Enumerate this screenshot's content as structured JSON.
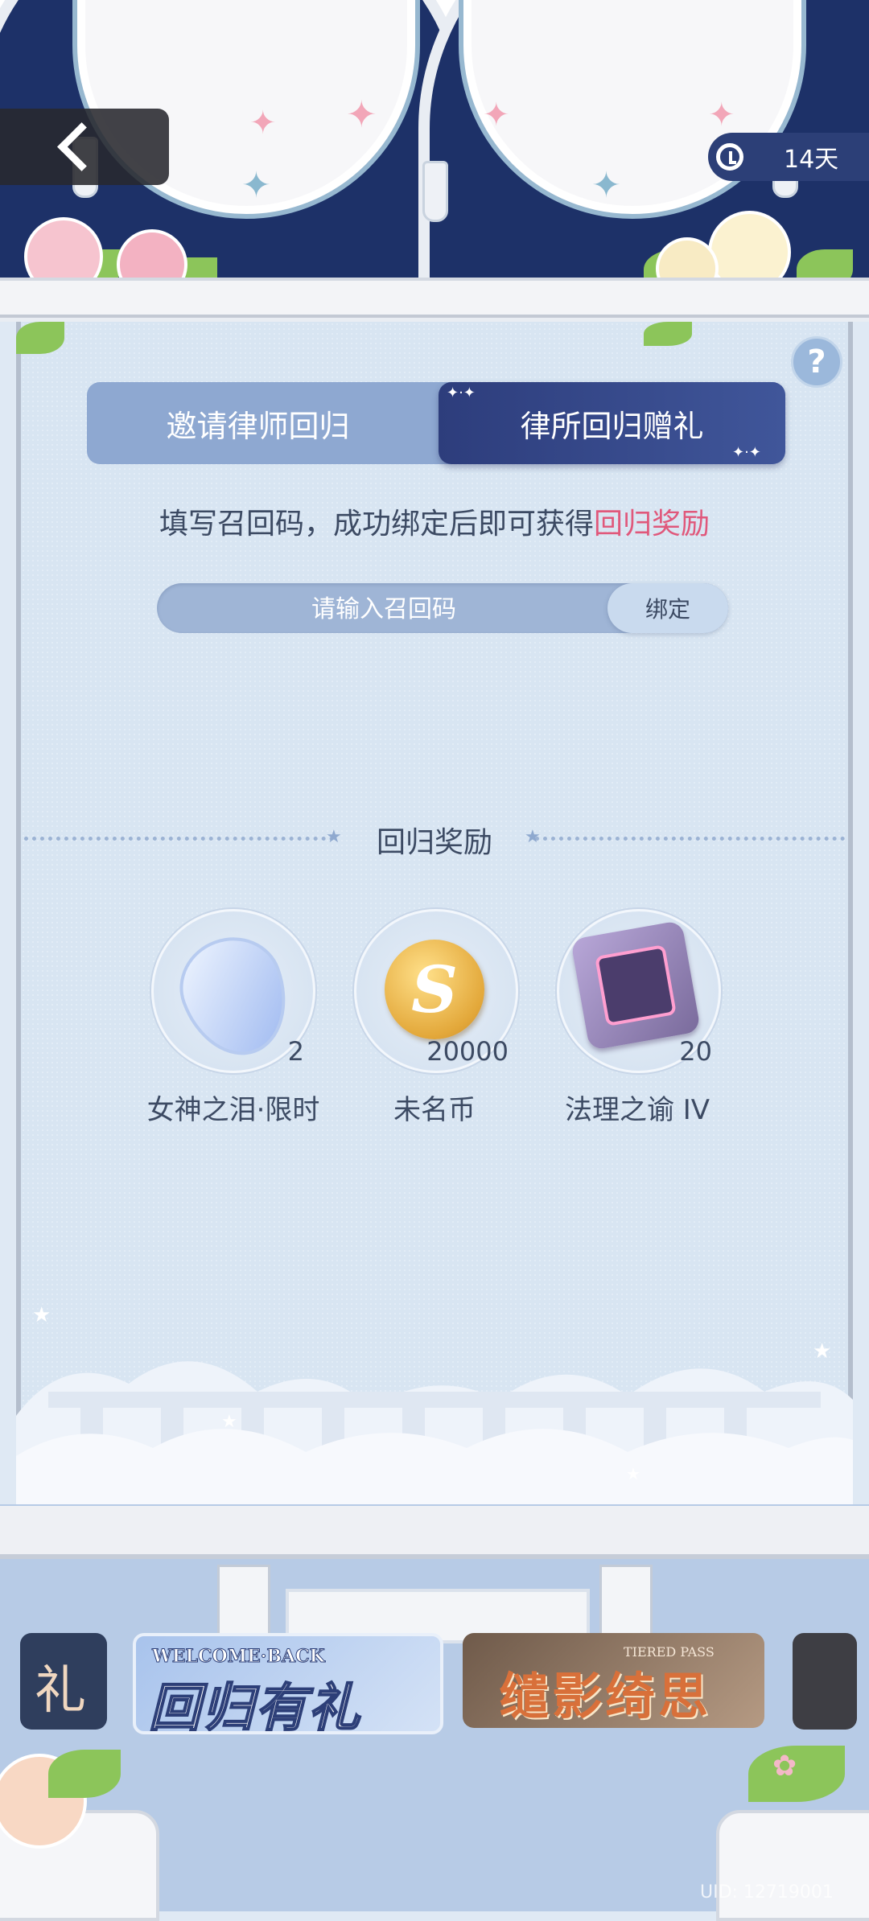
{
  "header": {
    "days_left": "14天"
  },
  "tabs": [
    {
      "label": "邀请律师回归",
      "active": false
    },
    {
      "label": "律所回归赠礼",
      "active": true
    }
  ],
  "instruction": {
    "text": "填写召回码，成功绑定后即可获得",
    "highlight": "回归奖励"
  },
  "code_input": {
    "placeholder": "请输入召回码",
    "value": "",
    "bind_label": "绑定"
  },
  "help_label": "?",
  "rewards": {
    "title": "回归奖励",
    "items": [
      {
        "icon": "tear-crystal-icon",
        "count": "2",
        "label": "女神之泪·限时"
      },
      {
        "icon": "coin-icon",
        "count": "20000",
        "label": "未名币"
      },
      {
        "icon": "chip-icon",
        "count": "20",
        "label": "法理之谕 IV"
      }
    ]
  },
  "banners": {
    "left_partial": "礼",
    "welcome_back": {
      "sub": "WELCOME·BACK",
      "main": "回归有礼"
    },
    "tiered_pass": {
      "sub": "TIERED PASS",
      "main": "缱影绮思"
    }
  },
  "coin_symbol": "S",
  "uid": "UID: 12719001",
  "colors": {
    "navy": "#1d3168",
    "tab_active": "#2d3d7c",
    "highlight_pink": "#e0587b",
    "panel_bg": "#d8e5f2"
  }
}
